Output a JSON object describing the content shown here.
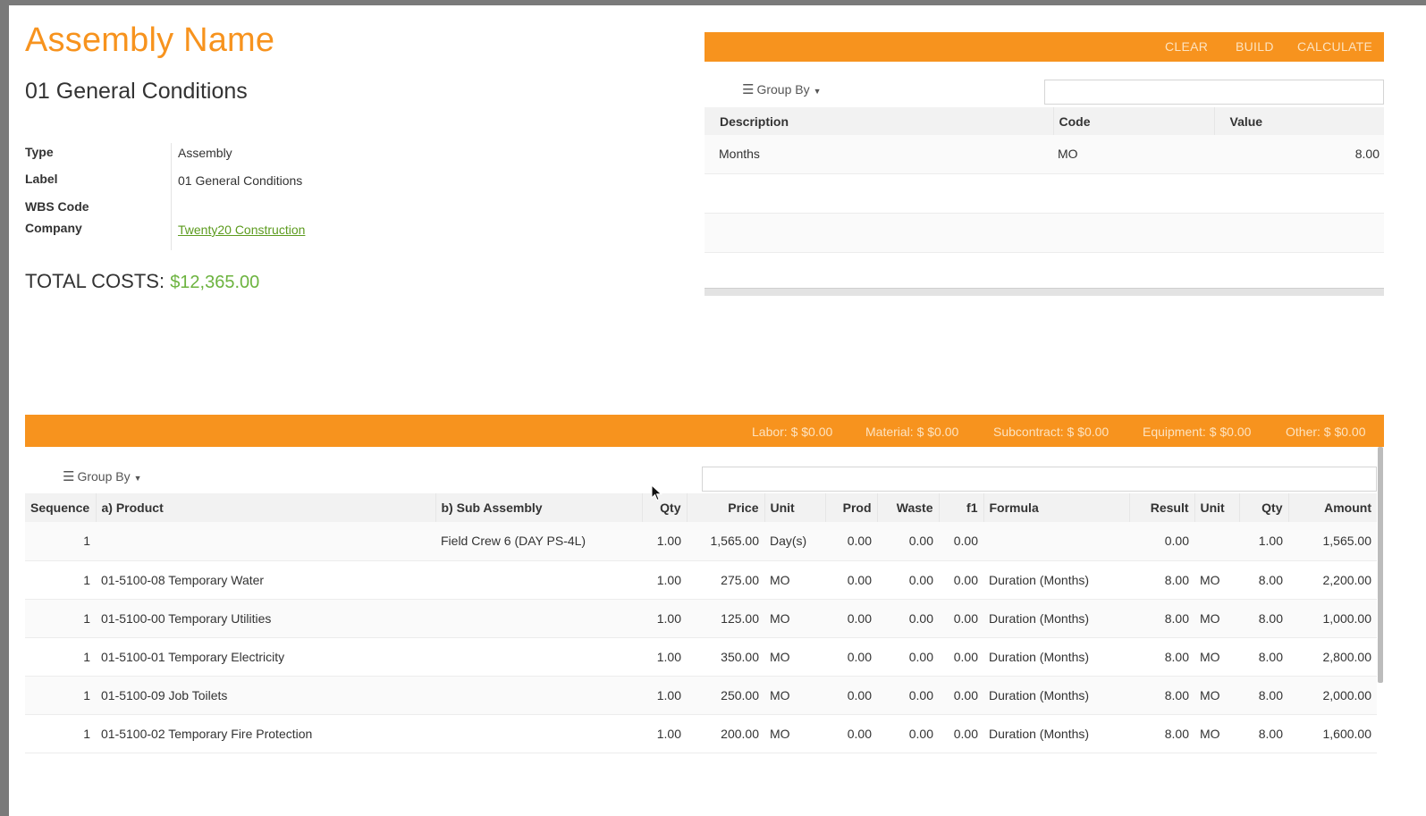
{
  "assembly": {
    "title": "Assembly Name",
    "subtitle": "01 General Conditions"
  },
  "properties": [
    {
      "label": "Type",
      "value": "Assembly"
    },
    {
      "label": "Label",
      "value": "01 General Conditions"
    },
    {
      "label": "WBS Code",
      "value": ""
    },
    {
      "label": "Company",
      "value": "Twenty20 Construction"
    }
  ],
  "total": {
    "label": "TOTAL COSTS:",
    "value": "$12,365.00"
  },
  "variables_panel": {
    "buttons": {
      "clear": "CLEAR",
      "build": "BUILD",
      "calculate": "CALCULATE"
    },
    "group_by": "Group By",
    "search_value": "",
    "columns": [
      "Description",
      "Code",
      "Value"
    ],
    "rows": [
      {
        "description": "Months",
        "code": "MO",
        "value": "8.00"
      }
    ]
  },
  "cost_summary": {
    "labor": "Labor: $ $0.00",
    "material": "Material: $ $0.00",
    "subcontract": "Subcontract: $ $0.00",
    "equipment": "Equipment: $ $0.00",
    "other": "Other: $ $0.00"
  },
  "items_panel": {
    "group_by": "Group By",
    "search_value": "",
    "columns": [
      "Sequence",
      "a) Product",
      "b) Sub Assembly",
      "Qty",
      "Price",
      "Unit",
      "Prod",
      "Waste",
      "f1",
      "Formula",
      "Result",
      "Unit",
      "Qty",
      "Amount"
    ],
    "rows": [
      {
        "sequence": "1",
        "product": "",
        "sub_assembly": "Field Crew 6 (DAY PS-4L)",
        "qty": "1.00",
        "price": "1,565.00",
        "unit": "Day(s)",
        "prod": "0.00",
        "waste": "0.00",
        "f1": "0.00",
        "formula": "",
        "result": "0.00",
        "unit2": "",
        "qty2": "1.00",
        "amount": "1,565.00"
      },
      {
        "sequence": "1",
        "product": "01-5100-08 Temporary Water",
        "sub_assembly": "",
        "qty": "1.00",
        "price": "275.00",
        "unit": "MO",
        "prod": "0.00",
        "waste": "0.00",
        "f1": "0.00",
        "formula": "Duration (Months)",
        "result": "8.00",
        "unit2": "MO",
        "qty2": "8.00",
        "amount": "2,200.00"
      },
      {
        "sequence": "1",
        "product": "01-5100-00 Temporary Utilities",
        "sub_assembly": "",
        "qty": "1.00",
        "price": "125.00",
        "unit": "MO",
        "prod": "0.00",
        "waste": "0.00",
        "f1": "0.00",
        "formula": "Duration (Months)",
        "result": "8.00",
        "unit2": "MO",
        "qty2": "8.00",
        "amount": "1,000.00"
      },
      {
        "sequence": "1",
        "product": "01-5100-01 Temporary Electricity",
        "sub_assembly": "",
        "qty": "1.00",
        "price": "350.00",
        "unit": "MO",
        "prod": "0.00",
        "waste": "0.00",
        "f1": "0.00",
        "formula": "Duration (Months)",
        "result": "8.00",
        "unit2": "MO",
        "qty2": "8.00",
        "amount": "2,800.00"
      },
      {
        "sequence": "1",
        "product": "01-5100-09 Job Toilets",
        "sub_assembly": "",
        "qty": "1.00",
        "price": "250.00",
        "unit": "MO",
        "prod": "0.00",
        "waste": "0.00",
        "f1": "0.00",
        "formula": "Duration (Months)",
        "result": "8.00",
        "unit2": "MO",
        "qty2": "8.00",
        "amount": "2,000.00"
      },
      {
        "sequence": "1",
        "product": "01-5100-02 Temporary Fire Protection",
        "sub_assembly": "",
        "qty": "1.00",
        "price": "200.00",
        "unit": "MO",
        "prod": "0.00",
        "waste": "0.00",
        "f1": "0.00",
        "formula": "Duration (Months)",
        "result": "8.00",
        "unit2": "MO",
        "qty2": "8.00",
        "amount": "1,600.00"
      }
    ]
  },
  "colors": {
    "accent": "#f7931e",
    "money": "#6cb33f",
    "link": "#5c9b1e"
  }
}
